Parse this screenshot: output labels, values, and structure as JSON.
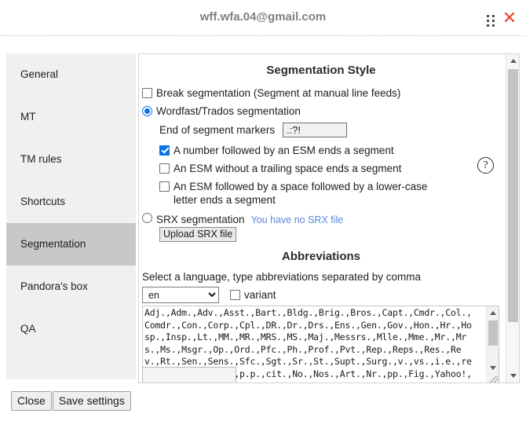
{
  "titlebar": {
    "account_email": "wff.wfa.04@gmail.com",
    "drag_handle_icon": "drag-dots-icon",
    "close_icon": "close-x-icon"
  },
  "sidebar": {
    "items": [
      {
        "label": "General",
        "selected": false
      },
      {
        "label": "MT",
        "selected": false
      },
      {
        "label": "TM rules",
        "selected": false
      },
      {
        "label": "Shortcuts",
        "selected": false
      },
      {
        "label": "Segmentation",
        "selected": true
      },
      {
        "label": "Pandora's box",
        "selected": false
      },
      {
        "label": "QA",
        "selected": false
      }
    ]
  },
  "footer": {
    "close_label": "Close",
    "save_label": "Save settings"
  },
  "segmentation": {
    "heading": "Segmentation Style",
    "break_segmentation_label": "Break segmentation (Segment at manual line feeds)",
    "break_segmentation_checked": false,
    "wordfast_label": "Wordfast/Trados segmentation",
    "wordfast_checked": true,
    "help_icon": "question-mark-icon",
    "esm_label": "End of segment markers",
    "esm_value": ".:?!",
    "sub_options": [
      {
        "label": "A number followed by an ESM ends a segment",
        "checked": true
      },
      {
        "label": "An ESM without a trailing space ends a segment",
        "checked": false
      },
      {
        "label": "An ESM followed by a space followed by a lower-case letter ends a segment",
        "checked": false
      }
    ],
    "srx_label": "SRX segmentation",
    "srx_checked": false,
    "srx_note": "You have no SRX file",
    "upload_srx_label": "Upload SRX file"
  },
  "abbreviations": {
    "heading": "Abbreviations",
    "instruction": "Select a language, type abbreviations separated by comma",
    "language_value": "en",
    "language_options": [
      "en"
    ],
    "variant_label": "variant",
    "variant_checked": false,
    "text": "Adj.,Adm.,Adv.,Asst.,Bart.,Bldg.,Brig.,Bros.,Capt.,Cmdr.,Col.,Comdr.,Con.,Corp.,Cpl.,DR.,Dr.,Drs.,Ens.,Gen.,Gov.,Hon.,Hr.,Hosp.,Insp.,Lt.,MM.,MR.,MRS.,MS.,Maj.,Messrs.,Mlle.,Mme.,Mr.,Mrs.,Ms.,Msgr.,Op.,Ord.,Pfc.,Ph.,Prof.,Pvt.,Rep.,Reps.,Res.,Rev.,Rt.,Sen.,Sens.,Sfc.,Sgt.,Sr.,St.,Supt.,Surg.,v.,vs.,i.e.,rev.,e.g.,min.,max.,p.p.,cit.,No.,Nos.,Art.,Nr.,pp.,Fig.,Yahoo!,Y!,Dr.,Mr.,Mrs.,Ms.,i.e.,e.g.,w.r.t.,approx.,ca.,cf.,vs.,fig.,St.,Ave.,Ste.,Ter"
  },
  "colors": {
    "accent_blue": "#0a72e8",
    "link_blue": "#5b87d8",
    "close_red": "#e8402a",
    "sidebar_bg": "#f0f0f0",
    "selected_bg": "#c8c8c8"
  }
}
